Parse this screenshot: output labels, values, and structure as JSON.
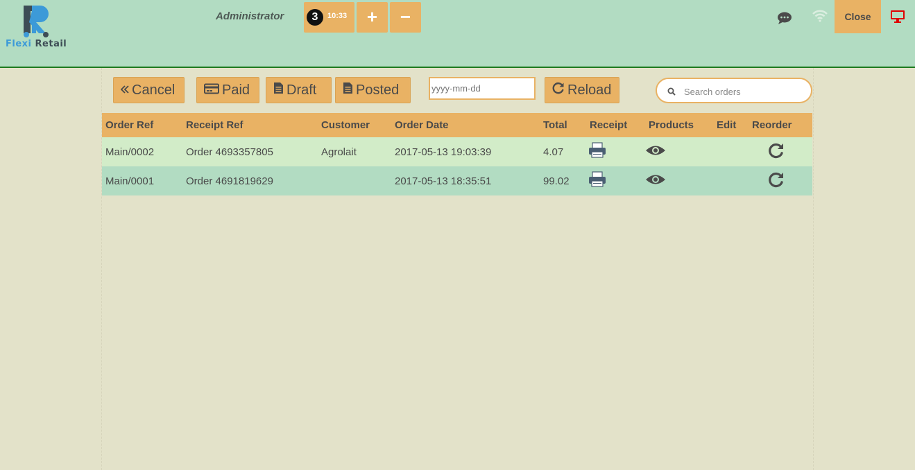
{
  "header": {
    "logo_text_a": "Flexi",
    "logo_text_b": "Retail",
    "user_name": "Administrator",
    "order_count": "3",
    "order_time": "10:33",
    "add_label": "+",
    "remove_label": "−",
    "close_label": "Close"
  },
  "toolbar": {
    "cancel_label": "Cancel",
    "paid_label": "Paid",
    "draft_label": "Draft",
    "posted_label": "Posted",
    "date_placeholder": "yyyy-mm-dd",
    "date_value": "",
    "reload_label": "Reload",
    "search_placeholder": "Search orders",
    "search_value": ""
  },
  "table": {
    "columns": [
      "Order Ref",
      "Receipt Ref",
      "Customer",
      "Order Date",
      "Total",
      "Receipt",
      "Products",
      "Edit",
      "Reorder"
    ],
    "rows": [
      {
        "order_ref": "Main/0002",
        "receipt_ref": "Order 4693357805",
        "customer": "Agrolait",
        "order_date": "2017-05-13 19:03:39",
        "total": "4.07"
      },
      {
        "order_ref": "Main/0001",
        "receipt_ref": "Order 4691819629",
        "customer": "",
        "order_date": "2017-05-13 18:35:51",
        "total": "99.02"
      }
    ]
  },
  "colors": {
    "header_bg": "#b2dcc2",
    "page_bg": "#e3e2c9",
    "accent": "#e9b264",
    "row_odd": "#d2ecc8",
    "row_even": "#b2dcc2",
    "status_red": "#e00000"
  },
  "icons": {
    "cancel": "double-chevron-left-icon",
    "paid": "credit-card-icon",
    "draft": "document-icon",
    "posted": "document-icon",
    "reload": "refresh-icon",
    "search": "search-icon",
    "chat": "chat-bubble-icon",
    "wifi": "wifi-icon",
    "screen": "monitor-icon",
    "receipt": "printer-icon",
    "products": "eye-icon",
    "reorder": "refresh-icon"
  }
}
